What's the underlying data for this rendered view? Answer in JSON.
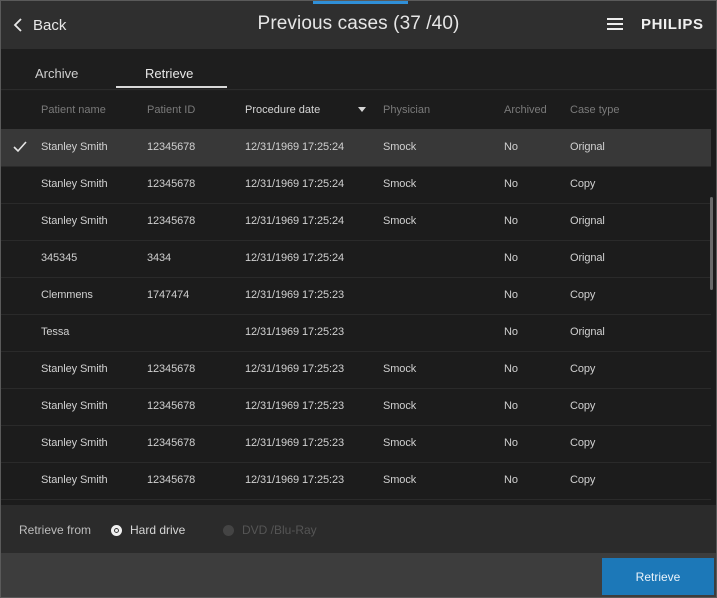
{
  "header": {
    "back_label": "Back",
    "title": "Previous cases (37 /40)",
    "brand": "PHILIPS"
  },
  "tabs": [
    {
      "label": "Archive",
      "active": false
    },
    {
      "label": "Retrieve",
      "active": true
    }
  ],
  "table": {
    "columns": [
      "Patient name",
      "Patient ID",
      "Procedure date",
      "Physician",
      "Archived",
      "Case type"
    ],
    "sort_column": "Procedure date",
    "rows": [
      {
        "name": "Stanley Smith",
        "pid": "12345678",
        "date": "12/31/1969 17:25:24",
        "phys": "Smock",
        "archived": "No",
        "type": "Orignal",
        "selected": true
      },
      {
        "name": "Stanley Smith",
        "pid": "12345678",
        "date": "12/31/1969 17:25:24",
        "phys": "Smock",
        "archived": "No",
        "type": "Copy",
        "selected": false
      },
      {
        "name": "Stanley Smith",
        "pid": "12345678",
        "date": "12/31/1969 17:25:24",
        "phys": "Smock",
        "archived": "No",
        "type": "Orignal",
        "selected": false
      },
      {
        "name": "345345",
        "pid": "3434",
        "date": "12/31/1969 17:25:24",
        "phys": "",
        "archived": "No",
        "type": "Orignal",
        "selected": false
      },
      {
        "name": "Clemmens",
        "pid": "1747474",
        "date": "12/31/1969 17:25:23",
        "phys": "",
        "archived": "No",
        "type": "Copy",
        "selected": false
      },
      {
        "name": "Tessa",
        "pid": "",
        "date": "12/31/1969 17:25:23",
        "phys": "",
        "archived": "No",
        "type": "Orignal",
        "selected": false
      },
      {
        "name": "Stanley Smith",
        "pid": "12345678",
        "date": "12/31/1969 17:25:23",
        "phys": "Smock",
        "archived": "No",
        "type": "Copy",
        "selected": false
      },
      {
        "name": "Stanley Smith",
        "pid": "12345678",
        "date": "12/31/1969 17:25:23",
        "phys": "Smock",
        "archived": "No",
        "type": "Copy",
        "selected": false
      },
      {
        "name": "Stanley Smith",
        "pid": "12345678",
        "date": "12/31/1969 17:25:23",
        "phys": "Smock",
        "archived": "No",
        "type": "Copy",
        "selected": false
      },
      {
        "name": "Stanley Smith",
        "pid": "12345678",
        "date": "12/31/1969 17:25:23",
        "phys": "Smock",
        "archived": "No",
        "type": "Copy",
        "selected": false
      }
    ]
  },
  "retrieve_from": {
    "label": "Retrieve from",
    "options": [
      {
        "label": "Hard drive",
        "selected": true,
        "enabled": true
      },
      {
        "label": "DVD /Blu-Ray",
        "selected": false,
        "enabled": false
      }
    ]
  },
  "footer": {
    "retrieve_button": "Retrieve"
  },
  "colors": {
    "accent": "#1c78b8",
    "background": "#1c1c1c",
    "header": "#2f2f2f",
    "selected_row": "#383838"
  },
  "icons": [
    "chevron-left-icon",
    "hamburger-menu-icon",
    "checkmark-icon",
    "sort-down-icon"
  ]
}
